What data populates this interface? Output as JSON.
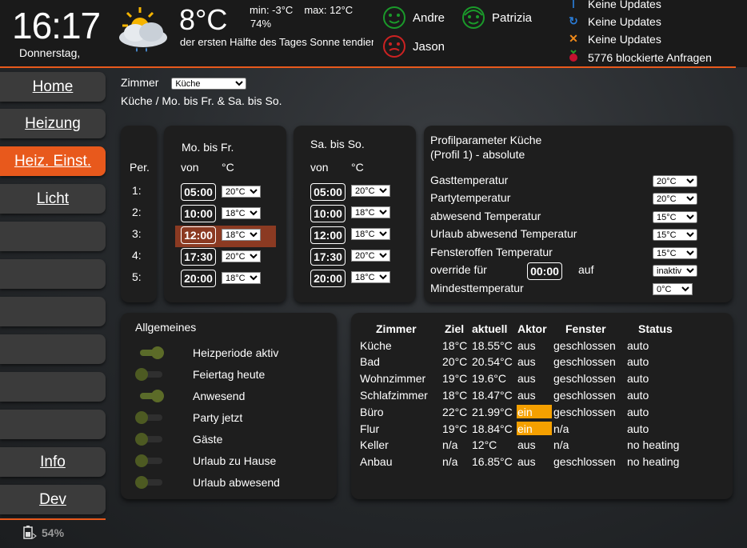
{
  "header": {
    "time": "16:17",
    "day": "Donnerstag,",
    "temperature": "8°C",
    "min": "min: -3°C",
    "max": "max: 12°C",
    "humidity": "74%",
    "description": "der ersten Hälfte des Tages Sonne tendiert",
    "persons": [
      {
        "name": "Andre",
        "color": "#1a9a2a"
      },
      {
        "name": "Patrizia",
        "color": "#1a9a2a"
      },
      {
        "name": "Jason",
        "color": "#cc2222"
      }
    ],
    "status": [
      {
        "icon": "info-icon",
        "text": "Keine Updates"
      },
      {
        "icon": "refresh-icon",
        "text": "Keine Updates"
      },
      {
        "icon": "x-icon",
        "text": "Keine Updates"
      },
      {
        "icon": "raspberry-icon",
        "text": "5776 blockierte Anfragen"
      }
    ]
  },
  "sidebar": {
    "items": [
      "Home",
      "Heizung",
      "Heiz. Einst.",
      "Licht",
      "",
      "",
      "",
      "",
      "",
      "",
      "Info",
      "Dev"
    ],
    "active": "Heiz. Einst.",
    "battery": "54%"
  },
  "room": {
    "label": "Zimmer",
    "selected": "Küche",
    "subtitle": "Küche / Mo. bis Fr. & Sa. bis So."
  },
  "periods": {
    "header": "Per.",
    "items": [
      "1:",
      "2:",
      "3:",
      "4:",
      "5:"
    ]
  },
  "weekday": {
    "title": "Mo. bis Fr.",
    "col_from": "von",
    "col_temp": "°C",
    "rows": [
      {
        "time": "05:00",
        "temp": "20°C"
      },
      {
        "time": "10:00",
        "temp": "18°C"
      },
      {
        "time": "12:00",
        "temp": "18°C"
      },
      {
        "time": "17:30",
        "temp": "20°C"
      },
      {
        "time": "20:00",
        "temp": "18°C"
      }
    ]
  },
  "weekend": {
    "title": "Sa. bis So.",
    "col_from": "von",
    "col_temp": "°C",
    "rows": [
      {
        "time": "05:00",
        "temp": "20°C"
      },
      {
        "time": "10:00",
        "temp": "18°C"
      },
      {
        "time": "12:00",
        "temp": "18°C"
      },
      {
        "time": "17:30",
        "temp": "20°C"
      },
      {
        "time": "20:00",
        "temp": "18°C"
      }
    ]
  },
  "profile": {
    "title_line1": "Profilparameter Küche",
    "title_line2": "(Profil 1) - absolute",
    "params": [
      {
        "label": "Gasttemperatur",
        "value": "20°C"
      },
      {
        "label": "Partytemperatur",
        "value": "20°C"
      },
      {
        "label": "abwesend Temperatur",
        "value": "15°C"
      },
      {
        "label": "Urlaub abwesend Temperatur",
        "value": "15°C"
      },
      {
        "label": "Fensteroffen Temperatur",
        "value": "15°C"
      }
    ],
    "override_label": "override für",
    "override_time": "00:00",
    "override_auf": "auf",
    "override_value": "inaktiv",
    "min_label": "Mindesttemperatur",
    "min_value": "0°C"
  },
  "general": {
    "title": "Allgemeines",
    "toggles": [
      {
        "label": "Heizperiode aktiv",
        "on": true
      },
      {
        "label": "Feiertag heute",
        "on": false
      },
      {
        "label": "Anwesend",
        "on": true
      },
      {
        "label": "Party jetzt",
        "on": false
      },
      {
        "label": "Gäste",
        "on": false
      },
      {
        "label": "Urlaub zu Hause",
        "on": false
      },
      {
        "label": "Urlaub abwesend",
        "on": false
      }
    ]
  },
  "status_table": {
    "headers": [
      "Zimmer",
      "Ziel",
      "aktuell",
      "Aktor",
      "Fenster",
      "Status"
    ],
    "rows": [
      [
        "Küche",
        "18°C",
        "18.55°C",
        "aus",
        "geschlossen",
        "auto"
      ],
      [
        "Bad",
        "20°C",
        "20.54°C",
        "aus",
        "geschlossen",
        "auto"
      ],
      [
        "Wohnzimmer",
        "19°C",
        "19.6°C",
        "aus",
        "geschlossen",
        "auto"
      ],
      [
        "Schlafzimmer",
        "18°C",
        "18.47°C",
        "aus",
        "geschlossen",
        "auto"
      ],
      [
        "Büro",
        "22°C",
        "21.99°C",
        "ein",
        "geschlossen",
        "auto"
      ],
      [
        "Flur",
        "19°C",
        "18.84°C",
        "ein",
        "n/a",
        "auto"
      ],
      [
        "Keller",
        "n/a",
        "12°C",
        "aus",
        "n/a",
        "no heating"
      ],
      [
        "Anbau",
        "n/a",
        "16.85°C",
        "aus",
        "geschlossen",
        "no heating"
      ]
    ],
    "highlight_color": "#f5a000"
  }
}
